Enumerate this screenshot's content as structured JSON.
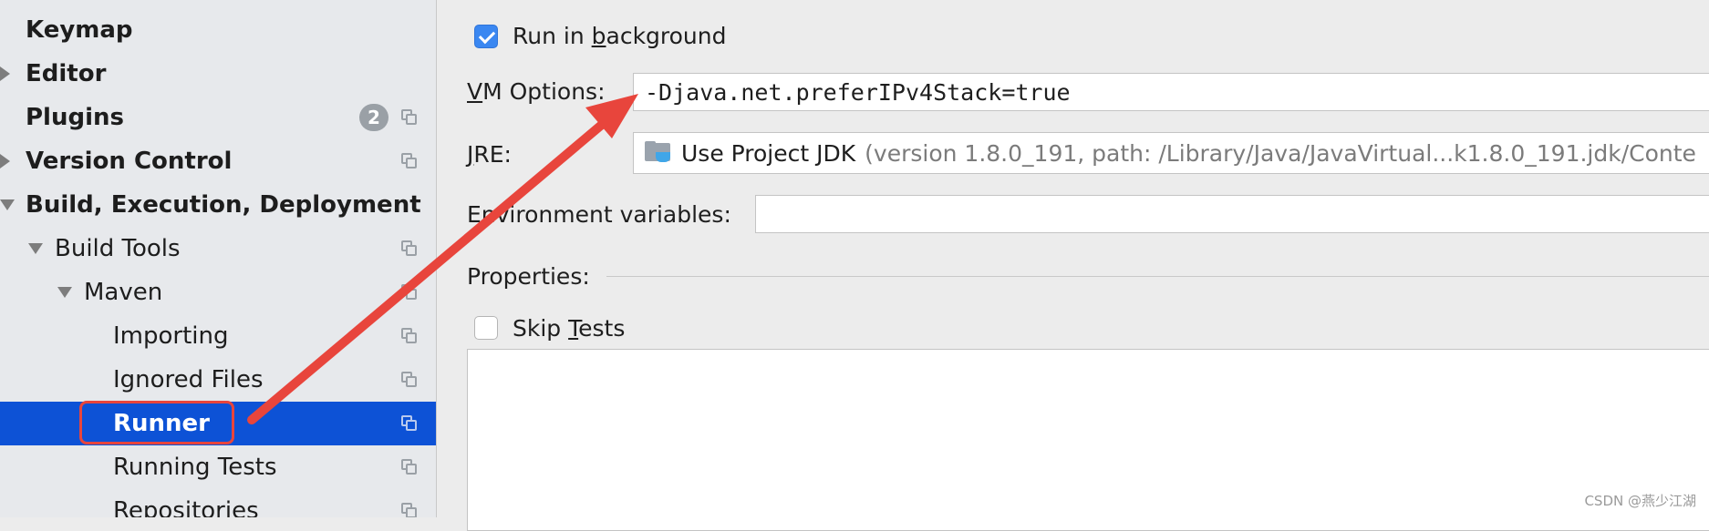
{
  "sidebar": {
    "items": [
      {
        "label": "Keymap",
        "level": 0,
        "bold": true,
        "arrow": "none",
        "copy_icon": false,
        "badge": null,
        "selected": false
      },
      {
        "label": "Editor",
        "level": 0,
        "bold": true,
        "arrow": "right",
        "copy_icon": false,
        "badge": null,
        "selected": false
      },
      {
        "label": "Plugins",
        "level": 0,
        "bold": true,
        "arrow": "none",
        "copy_icon": true,
        "badge": "2",
        "selected": false
      },
      {
        "label": "Version Control",
        "level": 0,
        "bold": true,
        "arrow": "right",
        "copy_icon": true,
        "badge": null,
        "selected": false
      },
      {
        "label": "Build, Execution, Deployment",
        "level": 0,
        "bold": true,
        "arrow": "down",
        "copy_icon": false,
        "badge": null,
        "selected": false
      },
      {
        "label": "Build Tools",
        "level": 1,
        "bold": false,
        "arrow": "down",
        "copy_icon": true,
        "badge": null,
        "selected": false
      },
      {
        "label": "Maven",
        "level": 2,
        "bold": false,
        "arrow": "down",
        "copy_icon": true,
        "badge": null,
        "selected": false
      },
      {
        "label": "Importing",
        "level": 3,
        "bold": false,
        "arrow": "none",
        "copy_icon": true,
        "badge": null,
        "selected": false
      },
      {
        "label": "Ignored Files",
        "level": 3,
        "bold": false,
        "arrow": "none",
        "copy_icon": true,
        "badge": null,
        "selected": false
      },
      {
        "label": "Runner",
        "level": 3,
        "bold": true,
        "arrow": "none",
        "copy_icon": true,
        "badge": null,
        "selected": true
      },
      {
        "label": "Running Tests",
        "level": 3,
        "bold": false,
        "arrow": "none",
        "copy_icon": true,
        "badge": null,
        "selected": false
      },
      {
        "label": "Repositories",
        "level": 3,
        "bold": false,
        "arrow": "none",
        "copy_icon": true,
        "badge": null,
        "selected": false
      }
    ]
  },
  "main": {
    "run_in_background": {
      "label_pre": "Run in ",
      "label_mnemonic": "b",
      "label_post": "ackground",
      "checked": true
    },
    "vm_options": {
      "label_mnemonic": "V",
      "label_post": "M Options:",
      "value": "-Djava.net.preferIPv4Stack=true"
    },
    "jre": {
      "label_mnemonic": "J",
      "label_post": "RE:",
      "value": "Use Project JDK",
      "detail": "(version 1.8.0_191, path: /Library/Java/JavaVirtual...k1.8.0_191.jdk/Conte",
      "icon": "jdk-folder-icon"
    },
    "env_vars": {
      "label": "Environment variables:",
      "value": ""
    },
    "properties": {
      "label": "Properties:"
    },
    "skip_tests": {
      "label_pre": "Skip ",
      "label_mnemonic": "T",
      "label_post": "ests",
      "checked": false
    }
  },
  "annotation": {
    "highlight_color": "#e8453c"
  },
  "watermark": "CSDN @燕少江湖",
  "colors": {
    "selection": "#0d52d6",
    "checkbox": "#3a87f1",
    "sidebar_bg": "#e7e9ec",
    "panel_bg": "#ececec"
  }
}
